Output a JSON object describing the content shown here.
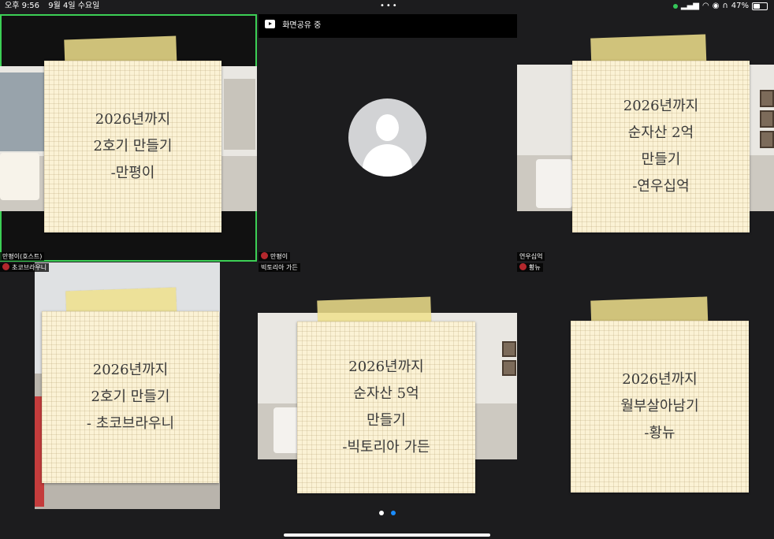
{
  "status": {
    "time": "오후 9:56",
    "date": "9월 4일 수요일",
    "dots": "•••",
    "battery": "47%",
    "battery_fraction": 0.47
  },
  "share": {
    "label": "화면공유 중"
  },
  "tiles": [
    {
      "note_lines": [
        "2026년까지",
        "2호기 만들기",
        "-만평이"
      ],
      "labels": [
        "만평이(호스트)",
        "초코브라우니"
      ]
    },
    {
      "labels": [
        "만평이",
        "빅토리아 가든"
      ]
    },
    {
      "note_lines": [
        "2026년까지",
        "순자산 2억",
        "만들기",
        "-연우십억"
      ],
      "labels": [
        "연우십억",
        "황뉴"
      ]
    },
    {
      "note_lines": [
        "2026년까지",
        "2호기 만들기",
        "- 초코브라우니"
      ]
    },
    {
      "note_lines": [
        "2026년까지",
        "순자산 5억",
        "만들기",
        "-빅토리아 가든"
      ]
    },
    {
      "note_lines": [
        "2026년까지",
        "월부살아남기",
        "-황뉴"
      ]
    }
  ],
  "pagination": {
    "pages": 2,
    "current": 2,
    "active_color": "#1a8cff",
    "inactive_color": "#ffffff"
  },
  "colors": {
    "active_speaker": "#3ccf55",
    "background": "#1c1c1e",
    "avatar_badge": "#b3282d"
  }
}
